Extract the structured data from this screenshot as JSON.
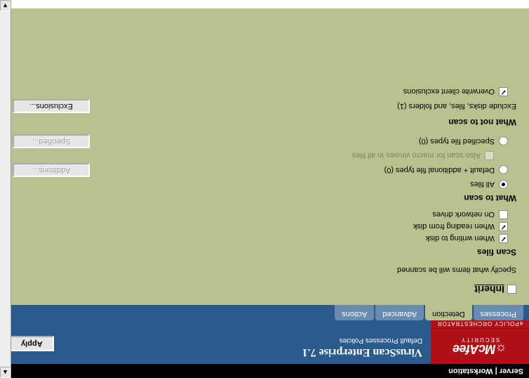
{
  "titlebar": "Server | Workstation",
  "brand": {
    "name": "McAfee",
    "sub": "SECURITY",
    "orch": "ePOLICY ORCHESTRATOR"
  },
  "header": {
    "product": "VirusScan Enterprise 7.1",
    "subtitle": "Default Processes Policies",
    "apply": "Apply"
  },
  "tabs": [
    "Processes",
    "Detection",
    "Advanced",
    "Actions"
  ],
  "active_tab": 1,
  "content": {
    "inherit": "Inherit",
    "desc": "Specify what items will be scanned",
    "scan_files": {
      "title": "Scan files",
      "writing": "When writing to disk",
      "reading": "When reading from disk",
      "network": "On network drives"
    },
    "what_to_scan": {
      "title": "What to scan",
      "all": "All files",
      "default_add": "Default + additional file types (0)",
      "macro": "Also scan for macro viruses in all files",
      "specified": "Specified file types (0)",
      "btn_add": "Additions...",
      "btn_spec": "Specified..."
    },
    "what_not": {
      "title": "What not to scan",
      "exclude": "Exclude disks, files, and folders (1)",
      "btn_excl": "Exclusions...",
      "overwrite": "Overwrite client exclusions"
    }
  }
}
